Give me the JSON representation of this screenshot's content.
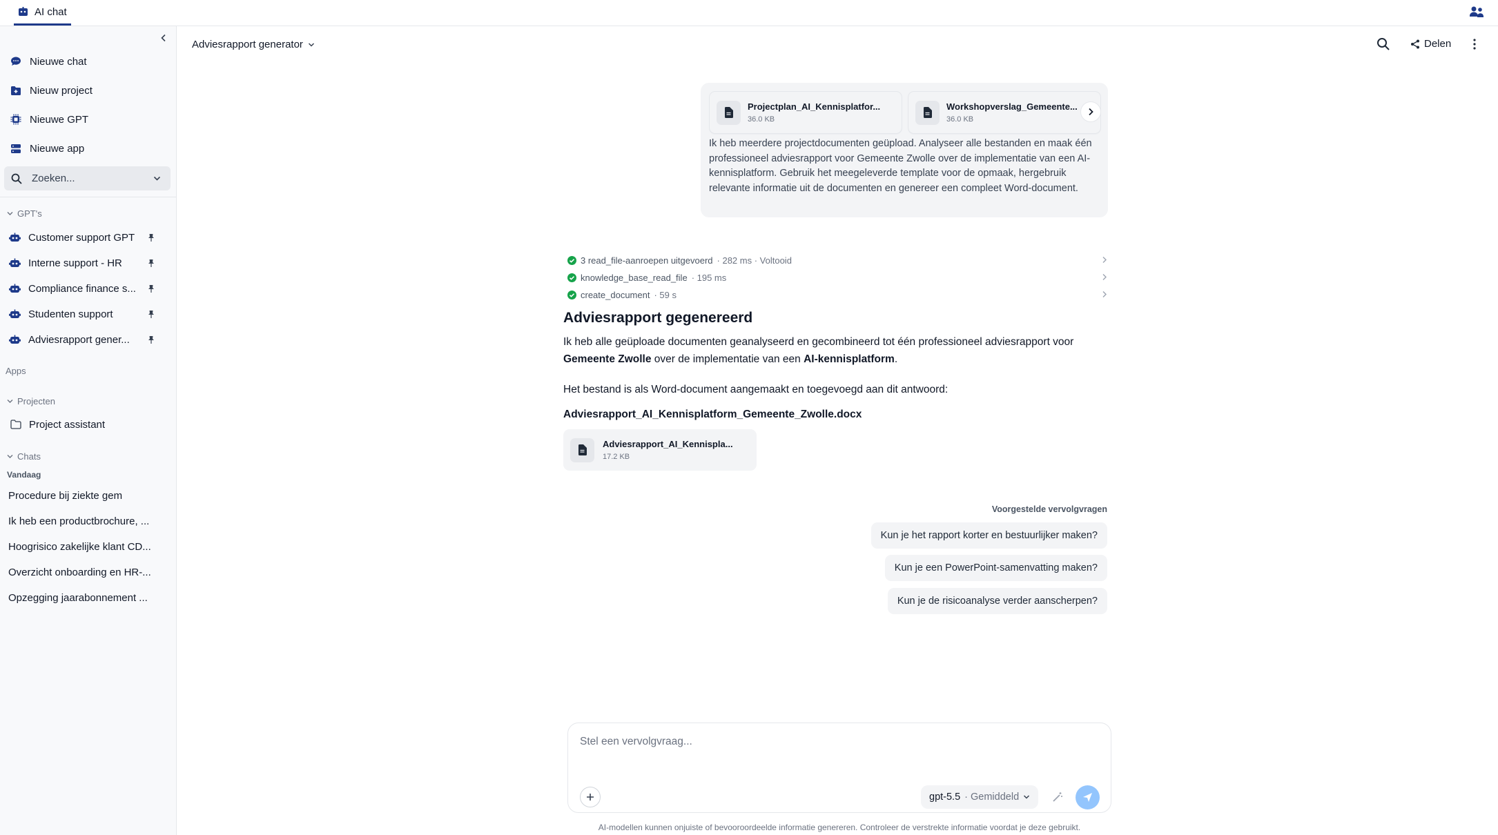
{
  "app_tab": {
    "label": "AI chat"
  },
  "sidebar": {
    "nav": [
      {
        "label": "Nieuwe chat",
        "icon": "chat-bubble-icon"
      },
      {
        "label": "Nieuw project",
        "icon": "folder-plus-icon"
      },
      {
        "label": "Nieuwe GPT",
        "icon": "chip-icon"
      },
      {
        "label": "Nieuwe app",
        "icon": "server-icon"
      }
    ],
    "search_placeholder": "Zoeken...",
    "gpts_heading": "GPT's",
    "gpts": [
      {
        "label": "Customer support GPT"
      },
      {
        "label": "Interne support - HR"
      },
      {
        "label": "Compliance finance s..."
      },
      {
        "label": "Studenten support"
      },
      {
        "label": "Adviesrapport gener..."
      }
    ],
    "apps_heading": "Apps",
    "projects_heading": "Projecten",
    "projects": [
      {
        "label": "Project assistant"
      }
    ],
    "chats_heading": "Chats",
    "today_heading": "Vandaag",
    "chats": [
      {
        "label": "Procedure bij ziekte gem"
      },
      {
        "label": "Ik heb een productbrochure, ..."
      },
      {
        "label": "Hoogrisico zakelijke klant CD..."
      },
      {
        "label": "Overzicht onboarding en HR-..."
      },
      {
        "label": "Opzegging jaarabonnement ..."
      }
    ]
  },
  "header": {
    "title": "Adviesrapport generator",
    "share_label": "Delen"
  },
  "user_message": {
    "files": [
      {
        "name": "Projectplan_AI_Kennisplatfor...",
        "size": "36.0 KB"
      },
      {
        "name": "Workshopverslag_Gemeente...",
        "size": "36.0 KB"
      }
    ],
    "text": "Ik heb meerdere projectdocumenten geüpload. Analyseer alle bestanden en maak één professioneel adviesrapport voor Gemeente Zwolle over de implementatie van een AI-kennisplatform. Gebruik het meegeleverde template voor de opmaak, hergebruik relevante informatie uit de documenten en genereer een compleet Word-document."
  },
  "tool_calls": [
    {
      "label": "3 read_file-aanroepen uitgevoerd",
      "meta": "· 282 ms  · Voltooid"
    },
    {
      "label": "knowledge_base_read_file",
      "meta": "· 195 ms"
    },
    {
      "label": "create_document",
      "meta": "· 59 s"
    }
  ],
  "answer": {
    "title": "Adviesrapport gegenereerd",
    "p1_a": "Ik heb alle geüploade documenten geanalyseerd en gecombineerd tot één professioneel adviesrapport voor ",
    "p1_b": "Gemeente Zwolle",
    "p1_c": " over de implementatie van een ",
    "p1_d": "AI-kennisplatform",
    "p1_e": ".",
    "p2": "Het bestand is als Word-document aangemaakt en toegevoegd aan dit antwoord:",
    "filename": "Adviesrapport_AI_Kennisplatform_Gemeente_Zwolle.docx",
    "attachment": {
      "name": "Adviesrapport_AI_Kennispla...",
      "size": "17.2 KB"
    }
  },
  "suggestions": {
    "label": "Voorgestelde vervolgvragen",
    "items": [
      "Kun je het rapport korter en bestuurlijker maken?",
      "Kun je een PowerPoint-samenvatting maken?",
      "Kun je de risicoanalyse verder aanscherpen?"
    ]
  },
  "composer": {
    "placeholder": "Stel een vervolgvraag...",
    "model": "gpt-5.5",
    "effort": "· Gemiddeld"
  },
  "disclaimer": "AI-modellen kunnen onjuiste of bevooroordeelde informatie genereren. Controleer de verstrekte informatie voordat je deze gebruikt.",
  "colors": {
    "accent": "#1e3a8a",
    "success": "#16a34a",
    "send": "#93c5fd"
  }
}
